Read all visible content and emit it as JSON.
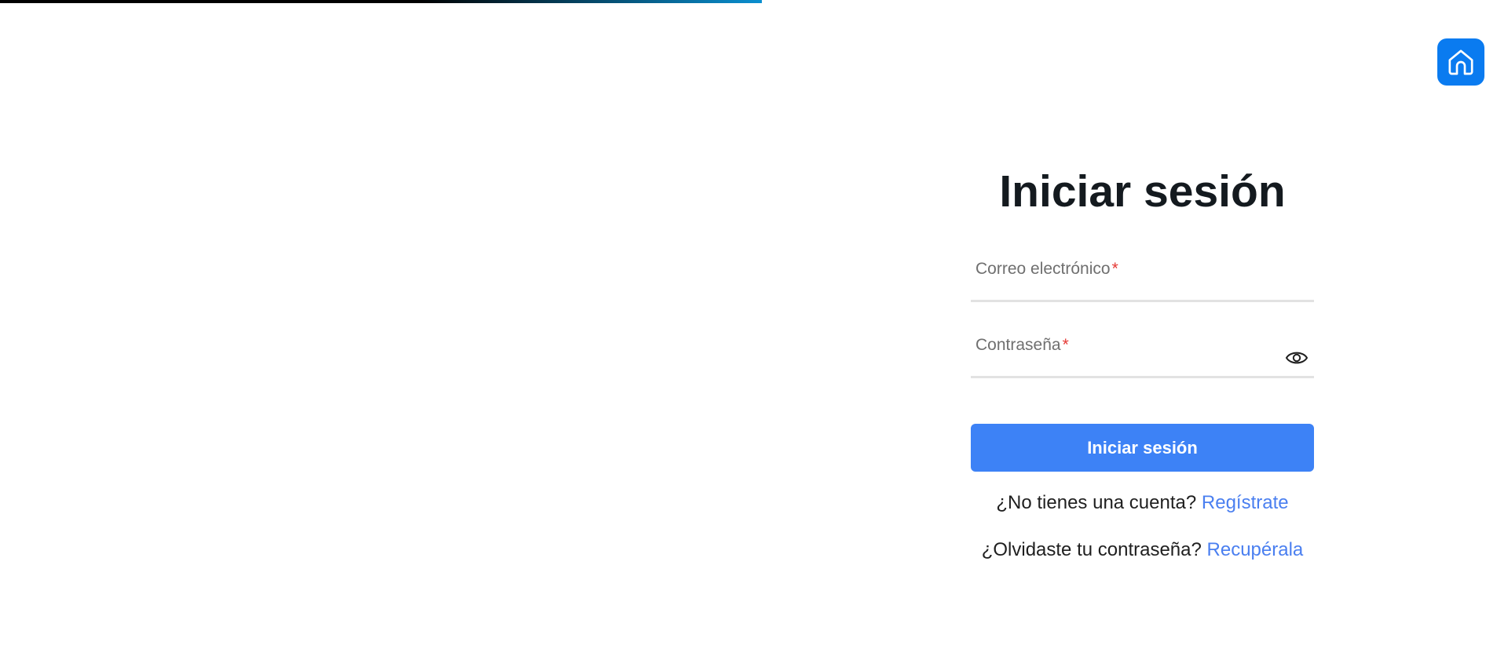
{
  "colors": {
    "top_bar_gradient_start": "#000000",
    "top_bar_gradient_end": "#0a8fd0",
    "home_button_bg": "#0a7bf0",
    "primary_button_bg": "#3d82f6",
    "link": "#4a7ff0",
    "required_star": "#e53935"
  },
  "header": {
    "home_icon": "home-icon"
  },
  "login": {
    "title": "Iniciar sesión",
    "email": {
      "label": "Correo electrónico",
      "required_mark": "*",
      "value": ""
    },
    "password": {
      "label": "Contraseña",
      "required_mark": "*",
      "value": "",
      "toggle_icon": "eye-icon"
    },
    "submit_label": "Iniciar sesión",
    "register_prompt": "¿No tienes una cuenta?",
    "register_link": "Regístrate",
    "recover_prompt": "¿Olvidaste tu contraseña?",
    "recover_link": "Recupérala"
  }
}
